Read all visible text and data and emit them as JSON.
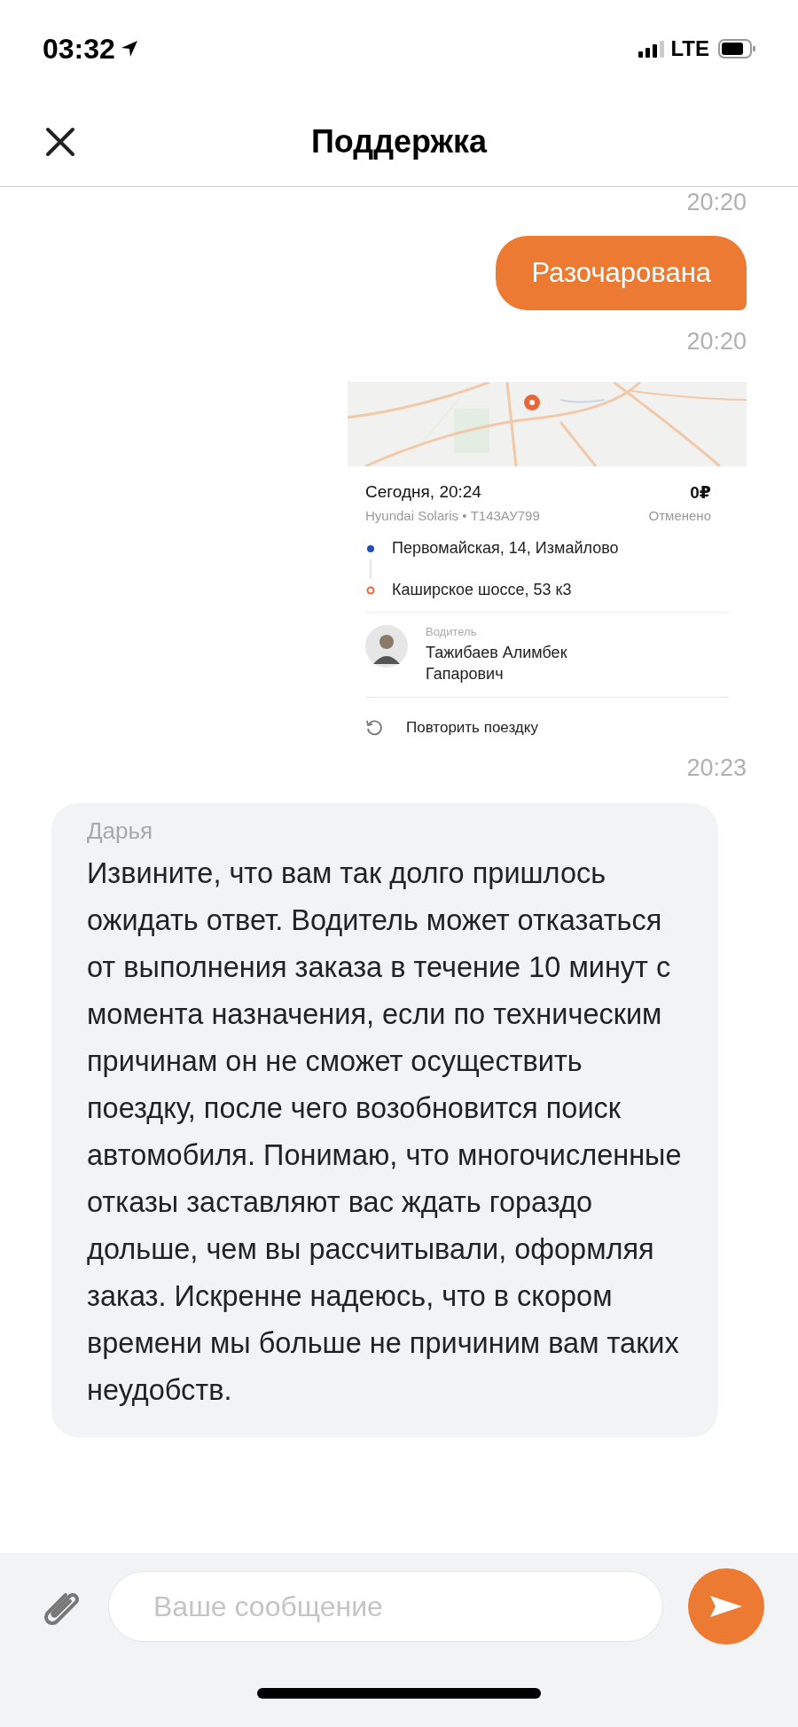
{
  "status_bar": {
    "time": "03:32",
    "network": "LTE"
  },
  "header": {
    "title": "Поддержка"
  },
  "messages": [
    {
      "kind": "time",
      "text": "20:20"
    },
    {
      "kind": "outgoing",
      "text": "Разочарована"
    },
    {
      "kind": "time",
      "text": "20:20"
    },
    {
      "kind": "trip",
      "date": "Сегодня, 20:24",
      "price": "0₽",
      "car": "Hyundai Solaris • Т143АУ799",
      "status": "Отменено",
      "route": [
        {
          "kind": "start",
          "address": "Первомайская, 14, Измайлово"
        },
        {
          "kind": "end",
          "address": "Каширское шоссе, 53 к3"
        }
      ],
      "driver_label": "Водитель",
      "driver_name": "Тажибаев Алимбек Гапарович",
      "repeat": "Повторить поездку"
    },
    {
      "kind": "time",
      "text": "20:23"
    },
    {
      "kind": "incoming",
      "author": "Дарья",
      "text": "Извините, что вам так долго пришлось ожидать ответ. Водитель может отказаться от выполнения заказа в течение 10 минут с момента назначения, если по техническим причинам он не сможет осуществить поездку, после чего возобновится поиск автомобиля. Понимаю, что многочисленные отказы заставляют вас ждать гораздо дольше, чем вы рассчитывали, оформляя заказ. Искренне надеюсь, что в скором времени мы больше не причиним вам таких неудобств."
    }
  ],
  "composer": {
    "placeholder": "Ваше сообщение"
  }
}
